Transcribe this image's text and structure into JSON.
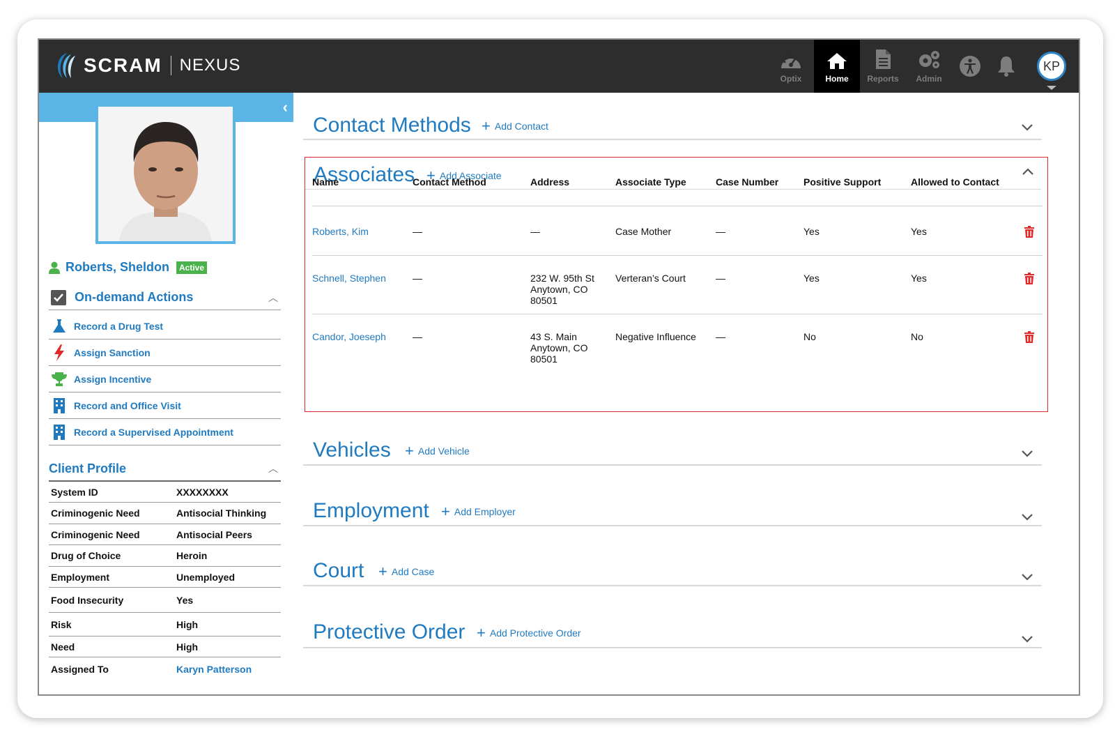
{
  "brand": {
    "name": "SCRAM",
    "product": "NEXUS"
  },
  "nav": [
    {
      "label": "Optix",
      "icon": "gauge-icon",
      "active": false
    },
    {
      "label": "Home",
      "icon": "home-icon",
      "active": true
    },
    {
      "label": "Reports",
      "icon": "document-icon",
      "active": false
    },
    {
      "label": "Admin",
      "icon": "gears-icon",
      "active": false
    }
  ],
  "user": {
    "initials": "KP"
  },
  "client": {
    "name": "Roberts, Sheldon",
    "status": "Active"
  },
  "actions": {
    "title": "On-demand Actions",
    "items": [
      {
        "label": "Record a Drug Test",
        "icon": "flask-icon"
      },
      {
        "label": "Assign Sanction",
        "icon": "lightning-icon"
      },
      {
        "label": "Assign Incentive",
        "icon": "trophy-icon"
      },
      {
        "label": "Record and Office Visit",
        "icon": "building-icon"
      },
      {
        "label": "Record a Supervised Appointment",
        "icon": "building-icon"
      }
    ]
  },
  "profile": {
    "title": "Client Profile",
    "rows": [
      {
        "key": "System ID",
        "value": "XXXXXXXX"
      },
      {
        "key": "Criminogenic Need",
        "value": "Antisocial Thinking"
      },
      {
        "key": "Criminogenic Need",
        "value": "Antisocial Peers"
      },
      {
        "key": "Drug of Choice",
        "value": "Heroin"
      },
      {
        "key": "Employment",
        "value": "Unemployed"
      },
      {
        "key": "Food Insecurity",
        "value": "Yes"
      },
      {
        "key": "Risk",
        "value": "High"
      },
      {
        "key": "Need",
        "value": "High"
      },
      {
        "key": "Assigned To",
        "value": "Karyn Patterson"
      }
    ]
  },
  "panels": {
    "contact": {
      "title": "Contact Methods",
      "add": "Add Contact"
    },
    "associates": {
      "title": "Associates",
      "add": "Add Associate"
    },
    "vehicles": {
      "title": "Vehicles",
      "add": "Add Vehicle"
    },
    "employment": {
      "title": "Employment",
      "add": "Add Employer"
    },
    "court": {
      "title": "Court",
      "add": "Add Case"
    },
    "protective": {
      "title": "Protective Order",
      "add": "Add Protective Order"
    }
  },
  "associates_table": {
    "columns": [
      "Name",
      "Contact Method",
      "Address",
      "Associate Type",
      "Case Number",
      "Positive Support",
      "Allowed to Contact"
    ],
    "rows": [
      {
        "name": "Roberts, Kim",
        "contact": "—",
        "address": [
          "—"
        ],
        "type": "Case Mother",
        "case": "—",
        "support": "Yes",
        "allowed": "Yes"
      },
      {
        "name": "Schnell, Stephen",
        "contact": "—",
        "address": [
          "232 W. 95th St",
          "Anytown, CO",
          "80501"
        ],
        "type": "Verteran’s Court",
        "case": "—",
        "support": "Yes",
        "allowed": "Yes"
      },
      {
        "name": "Candor, Joeseph",
        "contact": "—",
        "address": [
          "43 S. Main",
          "Anytown, CO",
          "80501"
        ],
        "type": "Negative Influence",
        "case": "—",
        "support": "No",
        "allowed": "No"
      }
    ]
  },
  "colors": {
    "accent": "#1f7ac0",
    "band": "#5ab4e6",
    "active": "#49b24a",
    "danger": "#e02a2a",
    "topbar": "#2d2d2d"
  }
}
